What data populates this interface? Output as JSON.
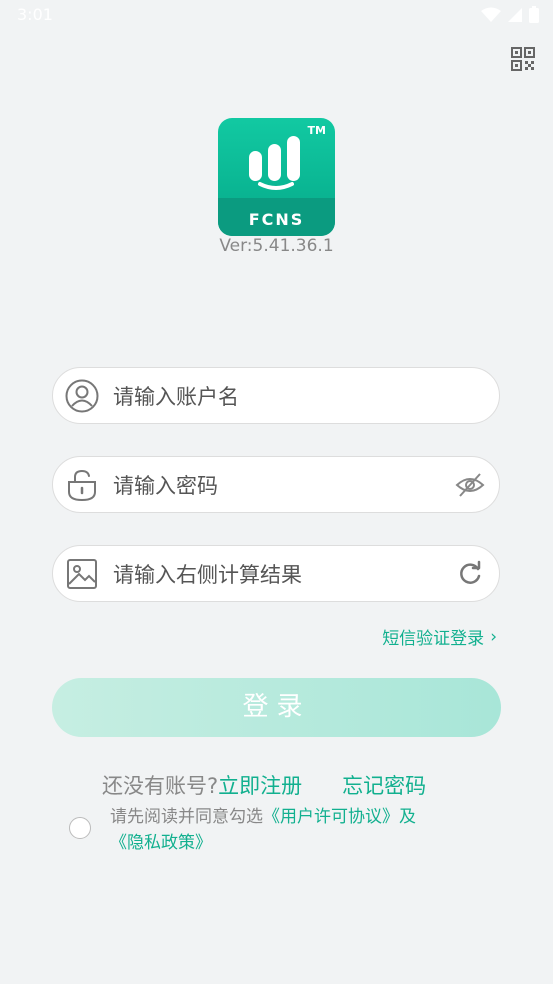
{
  "status_bar": {
    "time": "3:01"
  },
  "logo": {
    "brand": "FCNS",
    "tm": "TM"
  },
  "version": "Ver:5.41.36.1",
  "fields": {
    "account_placeholder": "请输入账户名",
    "password_placeholder": "请输入密码",
    "captcha_placeholder": "请输入右侧计算结果"
  },
  "sms_login": {
    "label": "短信验证登录",
    "chevron": "›"
  },
  "login_button": "登录",
  "register": {
    "prompt": "还没有账号?",
    "register_link": "立即注册",
    "forgot_link": "忘记密码"
  },
  "agreement": {
    "prefix": "请先阅读并同意勾选",
    "license": "《用户许可协议》",
    "and": "及",
    "privacy": "《隐私政策》"
  },
  "colors": {
    "accent": "#12b08f",
    "logo_green": "#0ab693",
    "background": "#f1f3f4"
  }
}
